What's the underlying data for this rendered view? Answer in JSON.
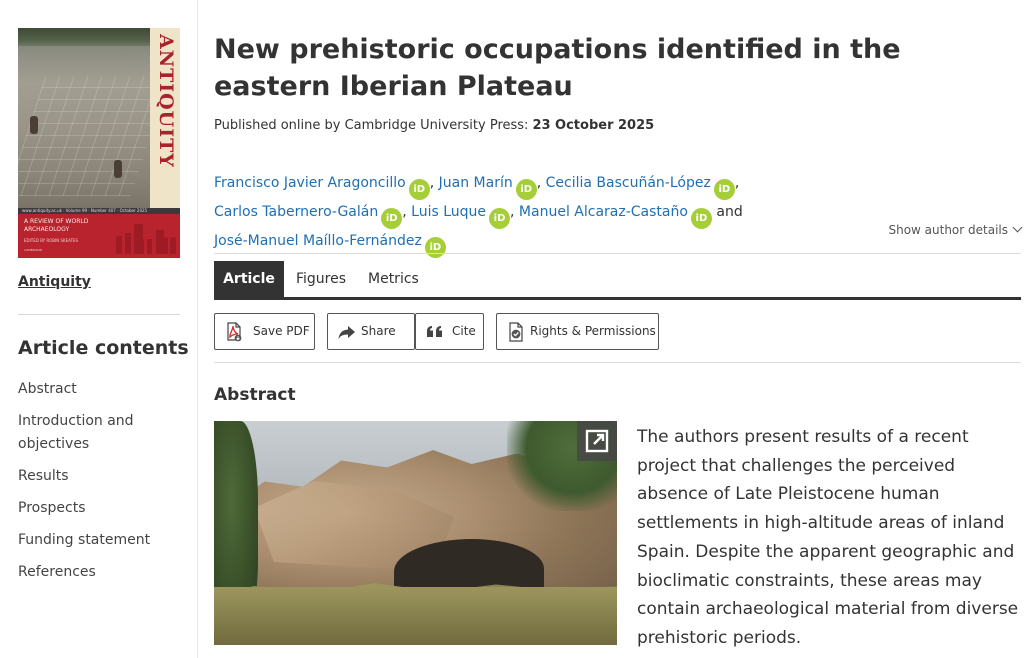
{
  "journal": {
    "cover": {
      "side_title": "ANTIQUITY",
      "strip_text": "www.antiquity.ac.uk · Volume 99 · Number 407 · October 2025",
      "band_title": "A REVIEW OF WORLD ARCHAEOLOGY",
      "band_editor": "EDITED BY ROBIN SKEATES",
      "band_meta": "CAMBRIDGE",
      "side_color": "#b8232d"
    },
    "link_label": "Antiquity"
  },
  "contents": {
    "title": "Article contents",
    "items": [
      {
        "label": "Abstract"
      },
      {
        "label": "Introduction and objectives"
      },
      {
        "label": "Results"
      },
      {
        "label": "Prospects"
      },
      {
        "label": "Funding statement"
      },
      {
        "label": "References"
      }
    ]
  },
  "article": {
    "title": "New prehistoric occupations identified in the eastern Iberian Plateau",
    "published_label": "Published online by Cambridge University Press:",
    "published_date": "23 October 2025",
    "authors": [
      {
        "name": "Francisco Javier Aragoncillo",
        "sep": ","
      },
      {
        "name": "Juan Marín",
        "sep": ","
      },
      {
        "name": "Cecilia Bascuñán-López",
        "sep": ","
      },
      {
        "name": "Carlos Tabernero-Galán",
        "sep": ","
      },
      {
        "name": "Luis Luque",
        "sep": ","
      },
      {
        "name": "Manuel Alcaraz-Castaño",
        "sep": "and"
      },
      {
        "name": "José-Manuel Maíllo-Fernández",
        "sep": ""
      }
    ],
    "orcid_badge": "iD",
    "show_details": "Show author details"
  },
  "tabs": [
    {
      "label": "Article",
      "active": true
    },
    {
      "label": "Figures",
      "active": false
    },
    {
      "label": "Metrics",
      "active": false
    }
  ],
  "actions": [
    {
      "label": "Save PDF",
      "icon": "pdf-icon"
    },
    {
      "label": "Share",
      "icon": "share-icon"
    },
    {
      "label": "Cite",
      "icon": "quote-icon"
    },
    {
      "label": "Rights & Permissions",
      "icon": "permissions-icon"
    }
  ],
  "abstract": {
    "heading": "Abstract",
    "text": "The authors present results of a recent project that challenges the perceived absence of Late Pleistocene human settlements in high-altitude areas of inland Spain. Despite the apparent geographic and bioclimatic constraints, these areas may contain archaeological material from diverse prehistoric periods."
  },
  "colors": {
    "link": "#1f6fb2",
    "orcid": "#a6ce39",
    "tab_active_bg": "#333333",
    "cover_red": "#b8232d"
  }
}
